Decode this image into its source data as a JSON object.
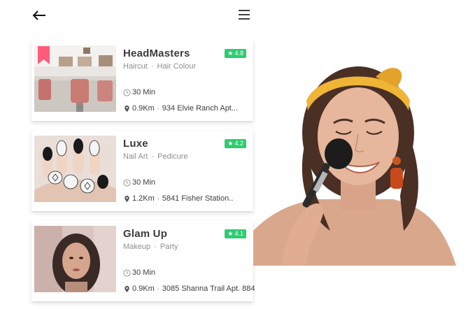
{
  "header": {
    "back_icon": "arrow-left-icon",
    "menu_icon": "hamburger-menu-icon"
  },
  "salons": [
    {
      "name": "HeadMasters",
      "rating": "4.8",
      "tag1": "Haircut",
      "tag2": "Hair Colour",
      "duration": "30 Min",
      "distance": "0.9Km",
      "address": "934 Elvie Ranch Apt...",
      "bookmarked": true
    },
    {
      "name": "Luxe",
      "rating": "4.2",
      "tag1": "Nail Art",
      "tag2": "Pedicure",
      "duration": "30 Min",
      "distance": "1.2Km",
      "address": "5841 Fisher Station..",
      "bookmarked": false
    },
    {
      "name": "Glam Up",
      "rating": "4.1",
      "tag1": "Makeup",
      "tag2": "Party",
      "duration": "30 Min",
      "distance": "0.9Km",
      "address": "3085 Shanna Trail Apt. 884",
      "bookmarked": false
    }
  ],
  "colors": {
    "rating_badge": "#2ecc71",
    "bookmark": "#ff5c7c",
    "title": "#3b3b3b",
    "tags": "#8e8e8e"
  }
}
